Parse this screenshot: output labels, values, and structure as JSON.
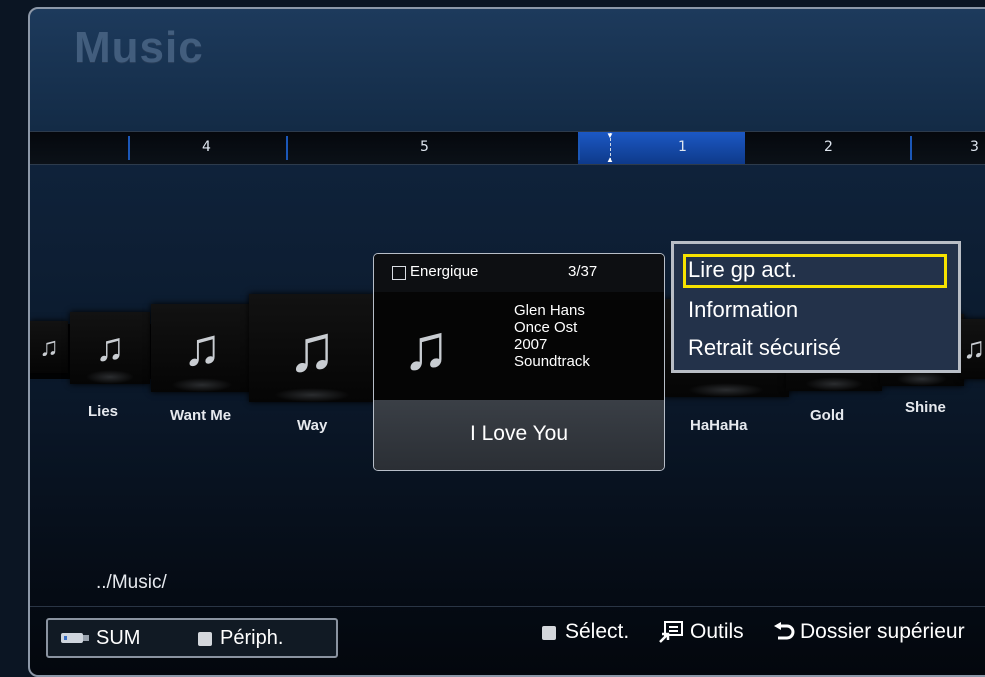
{
  "screen": {
    "title": "Music",
    "ruler": [
      "4",
      "5",
      "1",
      "2",
      "3"
    ],
    "songs": {
      "left": [
        "Lies",
        "Want Me",
        "Way"
      ],
      "right": [
        "HaHaHa",
        "Gold",
        "Shine"
      ]
    },
    "note_glyph": "♫",
    "path": "../Music/"
  },
  "card": {
    "mood": "Energique",
    "count": "3/37",
    "artist": "Glen Hans",
    "album": "Once Ost",
    "year": "2007",
    "genre": "Soundtrack",
    "title": "I Love You"
  },
  "menu": {
    "items": [
      "Lire gp act.",
      "Information",
      "Retrait sécurisé"
    ]
  },
  "bottom": {
    "sum_label": "SUM",
    "periph_label": "Périph.",
    "select_label": "Sélect.",
    "tools_label": "Outils",
    "parent_label": "Dossier supérieur"
  },
  "colors": {
    "selection": "#f7e300",
    "ruler_active": "#1c58c4",
    "title": "#4a6585"
  }
}
